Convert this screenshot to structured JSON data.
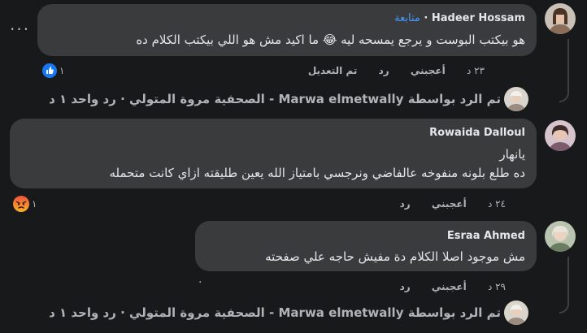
{
  "comments": [
    {
      "author": "Hadeer Hossam",
      "follow_label": "متابعة",
      "text": "هو بيكتب البوست و يرجع يمسحه ليه 😂 ما اكيد مش هو اللي بيكتب الكلام ده",
      "time": "٢٣ د",
      "like_label": "أعجبني",
      "reply_label": "رد",
      "edited_label": "تم التعديل",
      "reaction_count": "١",
      "reaction_type": "like",
      "reply_summary": "تم الرد بواسطة Marwa elmetwally - الصحفية مروة المتولي · رد واحد ١ د"
    },
    {
      "author": "Rowaida Dalloul",
      "text_lines": [
        "يانهار",
        "ده طلع بلونه منفوخه عالفاضي ونرجسي بامتياز الله يعين طليقته ازاي كانت متحمله"
      ],
      "time": "٢٤ د",
      "like_label": "أعجبني",
      "reply_label": "رد",
      "reaction_count": "١",
      "reaction_type": "angry"
    },
    {
      "author": "Esraa Ahmed",
      "text": "مش موجود اصلا الكلام دة مفيش حاجه علي صفحته",
      "time": "٢٩ د",
      "like_label": "أعجبني",
      "reply_label": "رد",
      "reply_summary": "تم الرد بواسطة Marwa elmetwally - الصحفية مروة المتولي · رد واحد ١ د"
    }
  ],
  "more_options_glyph": "···",
  "reply_indicator_glyph": "·",
  "colors": {
    "background": "#18191a",
    "bubble": "#3a3b3c",
    "text": "#e4e6eb",
    "secondary": "#b0b3b8",
    "follow": "#4599ff",
    "like_blue": "#1877f2"
  }
}
